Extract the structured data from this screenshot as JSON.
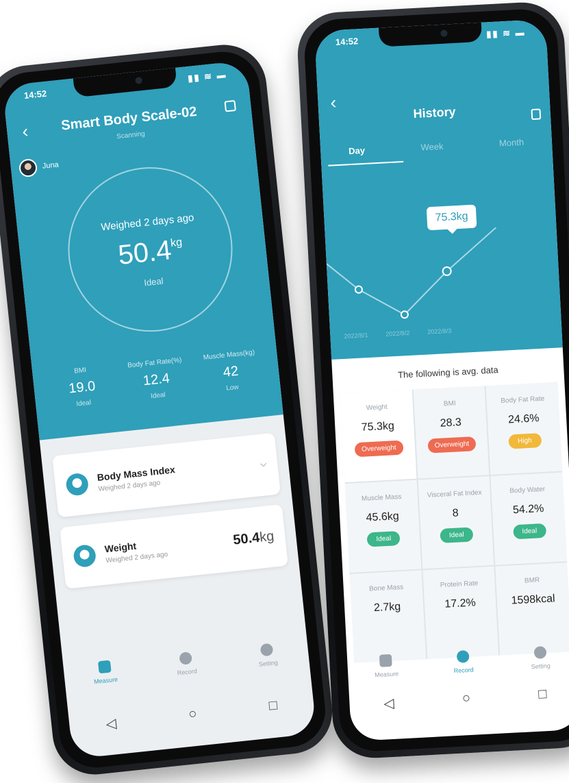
{
  "colors": {
    "accent": "#2f9fba",
    "overweight": "#ee6b52",
    "high": "#f1b83a",
    "ideal": "#3cb68a"
  },
  "left_phone": {
    "status_time": "14:52",
    "status_icons": "▮▮ ≋ ▬",
    "back_icon": "chevron-left-icon",
    "title": "Smart Body Scale-02",
    "subtitle": "Scanning",
    "share_icon": "share-icon",
    "user": {
      "name": "Juna"
    },
    "gauge": {
      "label": "Weighed 2 days ago",
      "value": "50.4",
      "unit": "kg",
      "status": "Ideal"
    },
    "metrics": [
      {
        "label": "BMI",
        "value": "19.0",
        "status": "Ideal"
      },
      {
        "label": "Body Fat Rate(%)",
        "value": "12.4",
        "status": "Ideal"
      },
      {
        "label": "Muscle Mass(kg)",
        "value": "42",
        "status": "Low"
      }
    ],
    "cards": [
      {
        "title": "Body Mass Index",
        "subtitle": "Weighed 2 days ago"
      },
      {
        "title": "Weight",
        "subtitle": "Weighed 2 days ago",
        "value": "50.4",
        "unit": "kg"
      }
    ],
    "tabs": [
      {
        "label": "Measure"
      },
      {
        "label": "Record"
      },
      {
        "label": "Setting"
      }
    ],
    "sysnav": {
      "back": "◁",
      "home": "○",
      "recent": "□"
    }
  },
  "right_phone": {
    "status_time": "14:52",
    "status_icons": "▮▮ ≋ ▬",
    "back_icon": "chevron-left-icon",
    "title": "History",
    "tabs": [
      {
        "label": "Day"
      },
      {
        "label": "Week"
      },
      {
        "label": "Month"
      }
    ],
    "tooltip": "75.3kg",
    "x_labels": [
      "2022/8/1",
      "2022/8/2",
      "2022/8/3"
    ],
    "avg_title": "The following is avg. data",
    "grid": [
      {
        "label": "Weight",
        "value": "75.3kg",
        "badge": "Overweight",
        "badge_color": "red"
      },
      {
        "label": "BMI",
        "value": "28.3",
        "badge": "Overweight",
        "badge_color": "red"
      },
      {
        "label": "Body Fat Rate",
        "value": "24.6%",
        "badge": "High",
        "badge_color": "yellow"
      },
      {
        "label": "Muscle Mass",
        "value": "45.6kg",
        "badge": "Ideal",
        "badge_color": "green"
      },
      {
        "label": "Visceral Fat Index",
        "value": "8",
        "badge": "Ideal",
        "badge_color": "green"
      },
      {
        "label": "Body Water",
        "value": "54.2%",
        "badge": "Ideal",
        "badge_color": "green"
      },
      {
        "label": "Bone Mass",
        "value": "2.7kg"
      },
      {
        "label": "Protein Rate",
        "value": "17.2%"
      },
      {
        "label": "BMR",
        "value": "1598kcal"
      }
    ],
    "bottom_tabs": [
      {
        "label": "Measure"
      },
      {
        "label": "Record"
      },
      {
        "label": "Setting"
      }
    ],
    "sysnav": {
      "back": "◁",
      "home": "○",
      "recent": "□"
    }
  }
}
